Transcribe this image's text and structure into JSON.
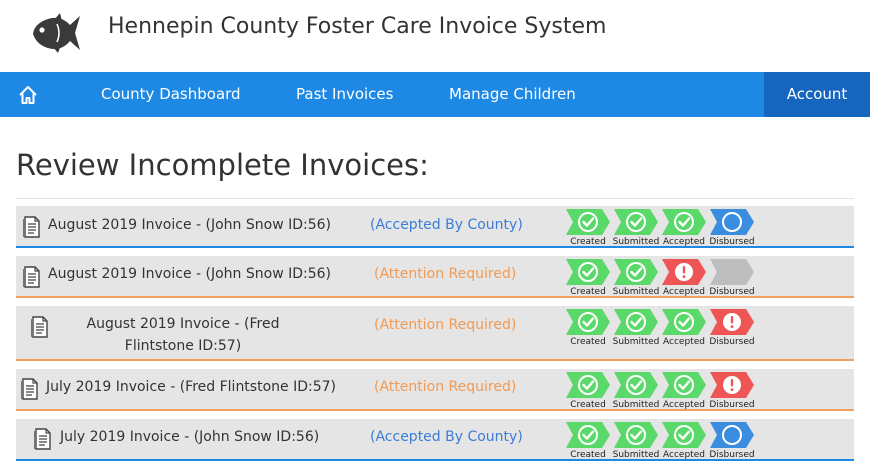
{
  "app": {
    "title": "Hennepin County Foster Care Invoice System"
  },
  "nav": {
    "home_icon": "home-icon",
    "items": [
      "County Dashboard",
      "Past Invoices",
      "Manage Children"
    ],
    "account": "Account"
  },
  "page": {
    "title": "Review Incomplete Invoices:"
  },
  "step_labels": [
    "Created",
    "Submitted",
    "Accepted",
    "Disbursed"
  ],
  "colors": {
    "nav": "#1e88e5",
    "account": "#1666c0",
    "done": "#5ad86a",
    "error": "#f05555",
    "pending": "#3b8de0",
    "inactive": "#bdbdbd",
    "status_blue": "#3b7dd8",
    "status_orange": "#f29a52"
  },
  "invoices": [
    {
      "label": "August 2019 Invoice - (John Snow ID:56)",
      "status": "(Accepted By County)",
      "steps": [
        "check",
        "check",
        "check",
        "pending"
      ]
    },
    {
      "label": "August 2019 Invoice - (John Snow ID:56)",
      "status": "(Attention Required)",
      "steps": [
        "check",
        "check",
        "error",
        "inactive"
      ]
    },
    {
      "label": "August 2019 Invoice - (Fred Flintstone ID:57)",
      "status": "(Attention Required)",
      "steps": [
        "check",
        "check",
        "check",
        "error"
      ]
    },
    {
      "label": "July 2019 Invoice - (Fred Flintstone ID:57)",
      "status": "(Attention Required)",
      "steps": [
        "check",
        "check",
        "check",
        "error"
      ]
    },
    {
      "label": "July 2019 Invoice - (John Snow ID:56)",
      "status": "(Accepted By County)",
      "steps": [
        "check",
        "check",
        "check",
        "pending"
      ]
    }
  ]
}
